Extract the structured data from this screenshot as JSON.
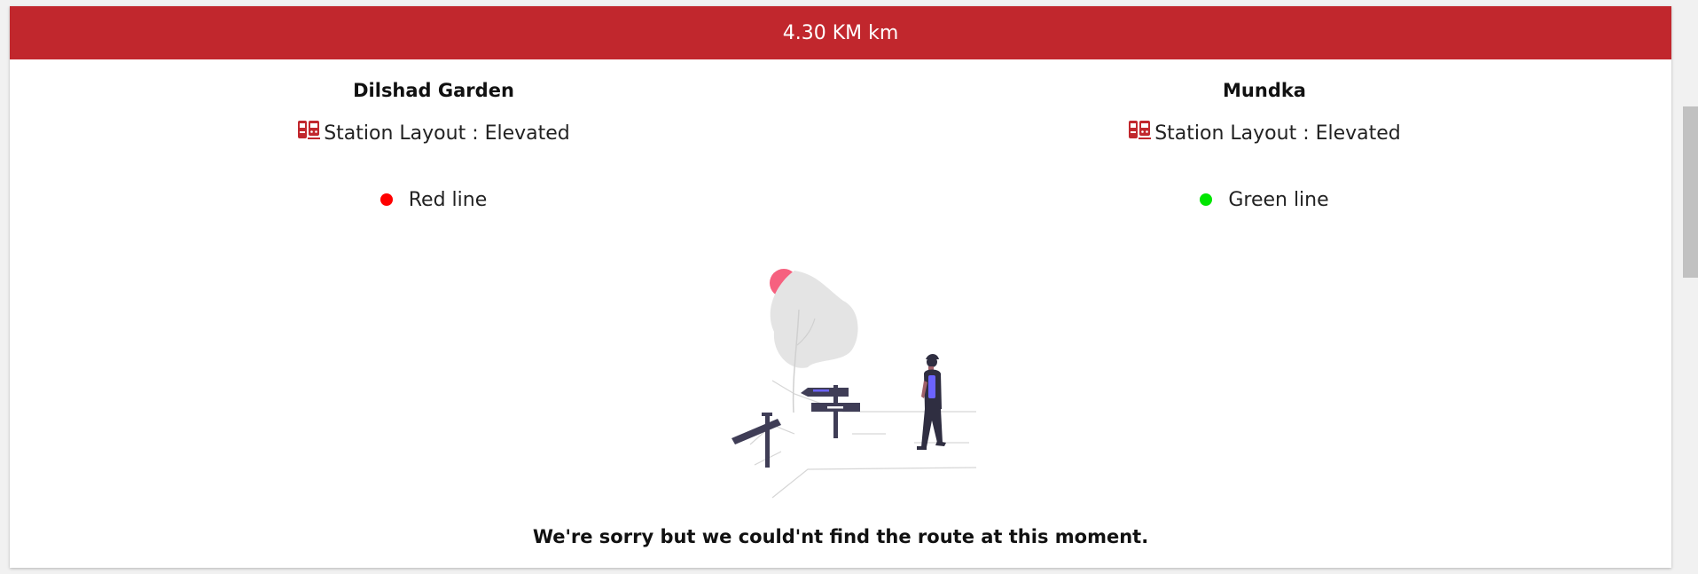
{
  "route": {
    "distance_label": "4.30 KM km"
  },
  "from_station": {
    "name": "Dilshad Garden",
    "layout_text": "Station Layout : Elevated",
    "line_name": "Red line",
    "line_color": "#ff0000",
    "layout_icon": "train-icon"
  },
  "to_station": {
    "name": "Mundka",
    "layout_text": "Station Layout : Elevated",
    "line_name": "Green line",
    "line_color": "#00e600",
    "layout_icon": "train-icon"
  },
  "error": {
    "message": "We're sorry but we could'nt find the route at this moment.",
    "illustration": "lost-walker-signpost-illustration"
  },
  "colors": {
    "accent": "#c1272d"
  }
}
